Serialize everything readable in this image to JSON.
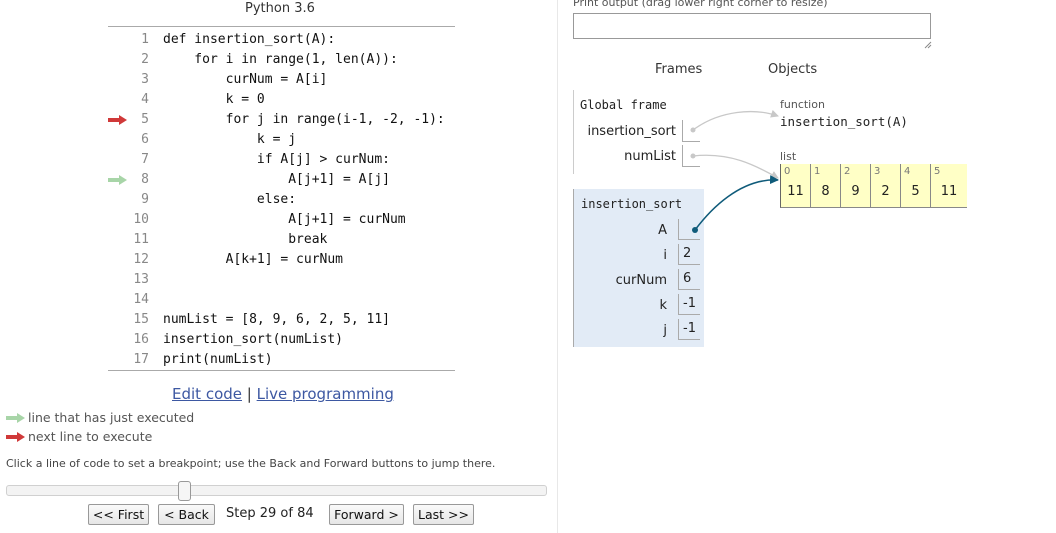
{
  "header": {
    "language": "Python 3.6"
  },
  "code": {
    "lines": [
      {
        "num": "1",
        "text": "def insertion_sort(A):"
      },
      {
        "num": "2",
        "text": "    for i in range(1, len(A)):"
      },
      {
        "num": "3",
        "text": "        curNum = A[i]"
      },
      {
        "num": "4",
        "text": "        k = 0"
      },
      {
        "num": "5",
        "text": "        for j in range(i-1, -2, -1):"
      },
      {
        "num": "6",
        "text": "            k = j"
      },
      {
        "num": "7",
        "text": "            if A[j] > curNum:"
      },
      {
        "num": "8",
        "text": "                A[j+1] = A[j]"
      },
      {
        "num": "9",
        "text": "            else:"
      },
      {
        "num": "10",
        "text": "                A[j+1] = curNum"
      },
      {
        "num": "11",
        "text": "                break"
      },
      {
        "num": "12",
        "text": "        A[k+1] = curNum"
      },
      {
        "num": "13",
        "text": ""
      },
      {
        "num": "14",
        "text": ""
      },
      {
        "num": "15",
        "text": "numList = [8, 9, 6, 2, 5, 11]"
      },
      {
        "num": "16",
        "text": "insertion_sort(numList)"
      },
      {
        "num": "17",
        "text": "print(numList)"
      }
    ],
    "next_line": "5",
    "just_executed_line": "8"
  },
  "links": {
    "edit_code": "Edit code",
    "separator": "|",
    "live_programming": "Live programming"
  },
  "legend": {
    "just_executed": "line that has just executed",
    "next_to_execute": "next line to execute"
  },
  "hint": "Click a line of code to set a breakpoint; use the Back and Forward buttons to jump there.",
  "navigation": {
    "first": "<< First",
    "back": "< Back",
    "step_text": "Step 29 of 84",
    "forward": "Forward >",
    "last": "Last >>",
    "current_step": 29,
    "total_steps": 84
  },
  "output": {
    "label": "Print output (drag lower right corner to resize)",
    "value": ""
  },
  "viz": {
    "frames_header": "Frames",
    "objects_header": "Objects",
    "global_frame": {
      "title": "Global frame",
      "vars": [
        {
          "name": "insertion_sort"
        },
        {
          "name": "numList"
        }
      ]
    },
    "stack_frame": {
      "title": "insertion_sort",
      "vars": [
        {
          "name": "A",
          "value": ""
        },
        {
          "name": "i",
          "value": "2"
        },
        {
          "name": "curNum",
          "value": "6"
        },
        {
          "name": "k",
          "value": "-1"
        },
        {
          "name": "j",
          "value": "-1"
        }
      ]
    },
    "function_object": {
      "type": "function",
      "name": "insertion_sort(A)"
    },
    "list_object": {
      "type": "list",
      "items": [
        {
          "index": "0",
          "value": "11"
        },
        {
          "index": "1",
          "value": "8"
        },
        {
          "index": "2",
          "value": "9"
        },
        {
          "index": "3",
          "value": "2"
        },
        {
          "index": "4",
          "value": "5"
        },
        {
          "index": "5",
          "value": "11"
        }
      ]
    },
    "colors": {
      "pointer": "#0f5b7a",
      "inactive_pointer": "#c8c8c8",
      "list_bg": "#ffffc6",
      "frame_bg": "#e2ebf6",
      "next_arrow": "#d03939",
      "executed_arrow": "#a8d5a8"
    }
  }
}
